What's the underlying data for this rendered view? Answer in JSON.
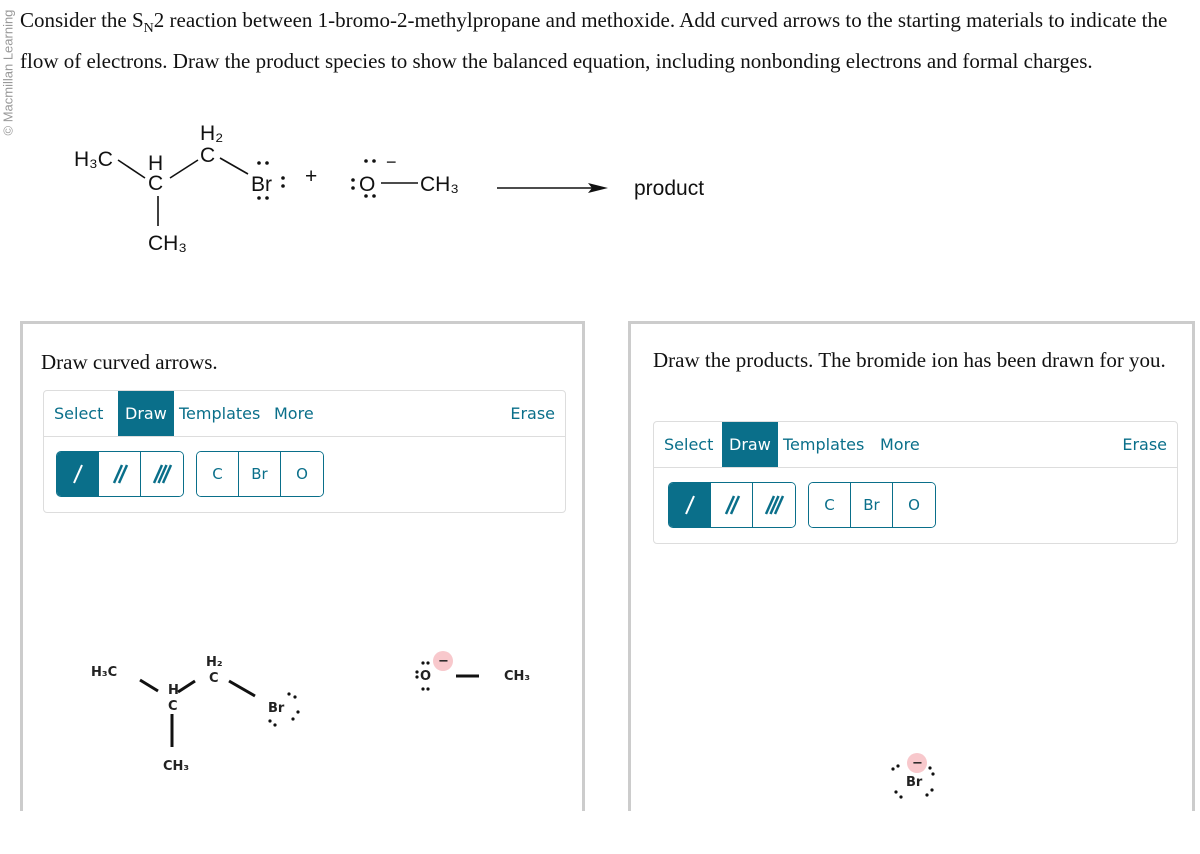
{
  "watermark": "© Macmillan Learning",
  "question": {
    "part1": "Consider the S",
    "subscript": "N",
    "part2": "2 reaction between 1-bromo-2-methylpropane and methoxide. Add curved arrows to the starting materials to indicate the flow of electrons. Draw the product species to show the balanced equation, including nonbonding electrons and formal charges."
  },
  "reaction": {
    "h3c": "H₃C",
    "h": "H",
    "c": "C",
    "h2": "H₂",
    "ch3": "CH₃",
    "br": "Br",
    "plus": "+",
    "o": "O",
    "minus": "−",
    "product_label": "product"
  },
  "left_panel": {
    "prompt": "Draw curved arrows.",
    "tabs": [
      "Select",
      "Draw",
      "Templates",
      "More"
    ],
    "active_tab": "Draw",
    "erase": "Erase",
    "bond_tools": [
      "single-bond",
      "double-bond",
      "triple-bond"
    ],
    "active_tool": "single-bond",
    "atom_tools": [
      "C",
      "Br",
      "O"
    ],
    "canvas": {
      "h3c": "H₃C",
      "h": "H",
      "c": "C",
      "h2": "H₂",
      "ch3": "CH₃",
      "br": "Br",
      "o": "O",
      "ch3_methoxide": "CH₃",
      "charge": "−"
    }
  },
  "right_panel": {
    "prompt": "Draw the products. The bromide ion has been drawn for you.",
    "tabs": [
      "Select",
      "Draw",
      "Templates",
      "More"
    ],
    "active_tab": "Draw",
    "erase": "Erase",
    "bond_tools": [
      "single-bond",
      "double-bond",
      "triple-bond"
    ],
    "active_tool": "single-bond",
    "atom_tools": [
      "C",
      "Br",
      "O"
    ],
    "canvas": {
      "br": "Br",
      "charge": "−"
    }
  },
  "colors": {
    "accent": "#0a6f8a",
    "charge_highlight": "#f8c8cc"
  }
}
